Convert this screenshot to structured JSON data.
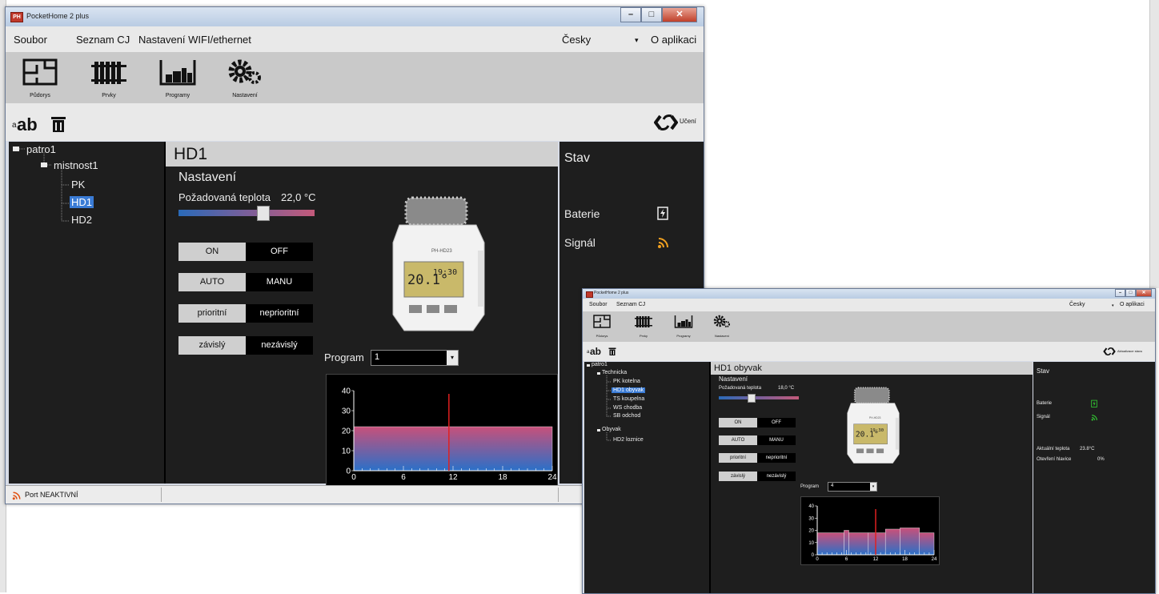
{
  "window1": {
    "title": "PocketHome 2 plus",
    "app_icon": "PH",
    "window_buttons": {
      "minimize": "–",
      "maximize": "□",
      "close": "✕"
    },
    "menu": {
      "file": "Soubor",
      "list": "Seznam CJ",
      "network": "Nastavení WIFI/ethernet",
      "language": "Česky",
      "language_arrow": "▾",
      "about": "O aplikaci"
    },
    "toolbar": {
      "floorplan": "Půdorys",
      "elements": "Prvky",
      "programs": "Programy",
      "settings": "Nastavení"
    },
    "actions": {
      "rename": "ab",
      "rename_prefix": "a",
      "refresh_label": "Učení"
    },
    "tree": [
      {
        "label": "patro1"
      },
      {
        "label": "mistnost1"
      },
      {
        "label": "PK"
      },
      {
        "label": "HD1"
      },
      {
        "label": "HD2"
      }
    ],
    "device": {
      "name": "HD1",
      "section": "Nastavení",
      "temp_label": "Požadovaná teplota",
      "temp_value": "22,0 °C",
      "temp_fraction": 0.62,
      "on": "ON",
      "off": "OFF",
      "auto": "AUTO",
      "manu": "MANU",
      "prio": "prioritní",
      "noprio": "neprioritní",
      "dep": "závislý",
      "indep": "nezávislý",
      "program_label": "Program",
      "program_value": "1",
      "image_text": {
        "brand": "PH-HD23",
        "lcd_big": "20.1°",
        "lcd_small": "19:30"
      }
    },
    "state": {
      "title": "Stav",
      "battery": "Baterie",
      "signal": "Signál"
    },
    "status": {
      "port": "Port NEAKTIVNÍ"
    }
  },
  "window2": {
    "title": "PocketHome 2 plus",
    "menu": {
      "file": "Soubor",
      "list": "Seznam CJ",
      "language": "Česky",
      "language_arrow": "▾",
      "about": "O aplikaci"
    },
    "toolbar": {
      "floorplan": "Půdorys",
      "elements": "Prvky",
      "programs": "Programy",
      "settings": "Nastavení"
    },
    "actions": {
      "rename": "ab",
      "rename_prefix": "a",
      "refresh_label": "Aktualizace stavu"
    },
    "tree": [
      {
        "label": "patro1"
      },
      {
        "label": "Technicka"
      },
      {
        "label": "PK kotelna"
      },
      {
        "label": "HD1 obyvak"
      },
      {
        "label": "TS koupelna"
      },
      {
        "label": "WS chodba"
      },
      {
        "label": "SB odchod"
      },
      {
        "label": "Obyvak"
      },
      {
        "label": "HD2 loznice"
      }
    ],
    "device": {
      "name": "HD1 obyvak",
      "section": "Nastavení",
      "temp_label": "Požadovaná teplota",
      "temp_value": "18,0 °C",
      "temp_fraction": 0.4,
      "on": "ON",
      "off": "OFF",
      "auto": "AUTO",
      "manu": "MANU",
      "prio": "prioritní",
      "noprio": "neprioritní",
      "dep": "závislý",
      "indep": "nezávislý",
      "program_label": "Program",
      "program_value": "4",
      "image_text": {
        "brand": "PH-HD23",
        "lcd_big": "20.1°",
        "lcd_small": "19:30"
      }
    },
    "state": {
      "title": "Stav",
      "battery": "Baterie",
      "signal": "Signál",
      "current_temp_label": "Aktuální teplota",
      "current_temp_value": "23.8°C",
      "valve_label": "Otevření hlavice",
      "valve_value": "0%"
    }
  },
  "colors": {
    "panel": "#1e1e1e",
    "selected": "#3a7bd5",
    "marker": "#e02020",
    "battery": "#33cc33",
    "signal_orange": "#f0a020",
    "signal_green": "#33cc33"
  },
  "chart_data": [
    {
      "type": "area",
      "xlabel": "",
      "ylabel": "",
      "x_ticks": [
        0,
        6,
        12,
        18,
        24
      ],
      "y_ticks": [
        0,
        10,
        20,
        30,
        40
      ],
      "xlim": [
        0,
        24
      ],
      "ylim": [
        0,
        40
      ],
      "segments": [
        {
          "x0": 0,
          "x1": 24,
          "y": 22
        }
      ],
      "marker_x": 11.5
    },
    {
      "type": "area",
      "xlabel": "",
      "ylabel": "",
      "x_ticks": [
        0,
        6,
        12,
        18,
        24
      ],
      "y_ticks": [
        0,
        10,
        20,
        30,
        40
      ],
      "xlim": [
        0,
        24
      ],
      "ylim": [
        0,
        40
      ],
      "segments": [
        {
          "x0": 0,
          "x1": 5.5,
          "y": 18
        },
        {
          "x0": 5.5,
          "x1": 6.5,
          "y": 20
        },
        {
          "x0": 6.5,
          "x1": 10.5,
          "y": 18
        },
        {
          "x0": 10.5,
          "x1": 14,
          "y": 18
        },
        {
          "x0": 14,
          "x1": 17,
          "y": 21
        },
        {
          "x0": 17,
          "x1": 21,
          "y": 22
        },
        {
          "x0": 21,
          "x1": 24,
          "y": 18
        }
      ],
      "marker_x": 12
    }
  ]
}
